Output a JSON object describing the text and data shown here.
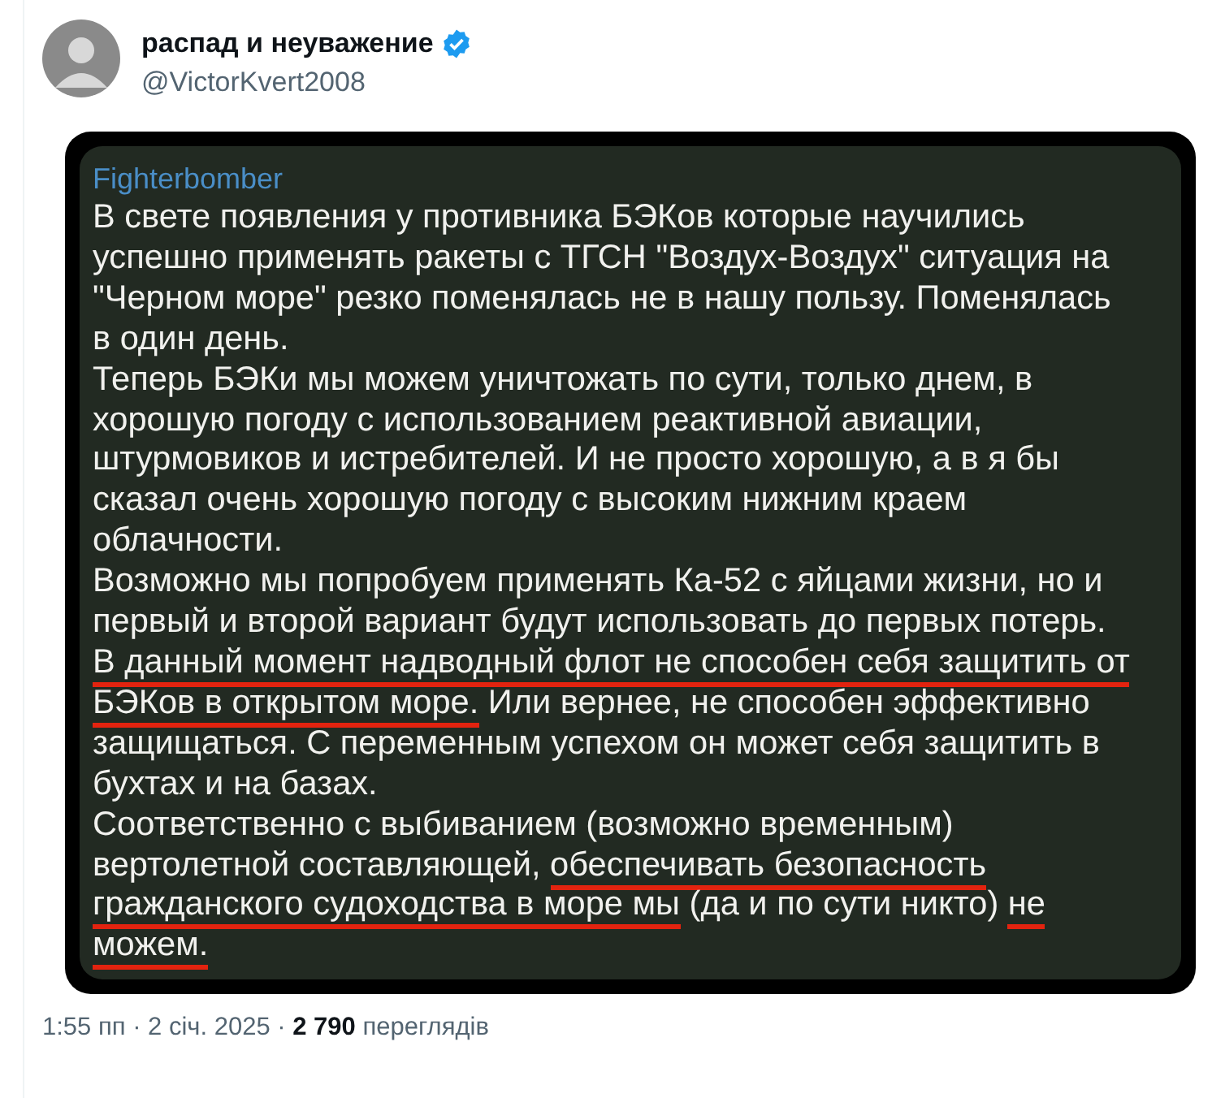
{
  "author": {
    "name": "распад и неуважение",
    "verified": true,
    "handle": "@VictorKvert2008"
  },
  "embedded_message": {
    "sender": "Fighterbomber",
    "lines": [
      [
        {
          "text": "В свете появления у противника БЭКов которые научились",
          "underlined": false
        }
      ],
      [
        {
          "text": "успешно применять ракеты с ТГСН \"Воздух-Воздух\" ситуация на",
          "underlined": false
        }
      ],
      [
        {
          "text": "\"Черном море\" резко поменялась не в нашу пользу. Поменялась",
          "underlined": false
        }
      ],
      [
        {
          "text": "в один день.",
          "underlined": false
        }
      ],
      [
        {
          "text": "Теперь БЭКи мы можем уничтожать по сути, только днем, в",
          "underlined": false
        }
      ],
      [
        {
          "text": "хорошую погоду с использованием реактивной авиации,",
          "underlined": false
        }
      ],
      [
        {
          "text": "штурмовиков и истребителей. И не просто хорошую, а в я бы",
          "underlined": false
        }
      ],
      [
        {
          "text": "сказал очень хорошую погоду с высоким нижним краем",
          "underlined": false
        }
      ],
      [
        {
          "text": "облачности.",
          "underlined": false
        }
      ],
      [
        {
          "text": "Возможно мы попробуем применять Ка-52 с яйцами жизни, но и",
          "underlined": false
        }
      ],
      [
        {
          "text": "первый и второй вариант будут использовать до первых потерь.",
          "underlined": false
        }
      ],
      [
        {
          "text": "В данный момент надводный флот не способен себя защитить от",
          "underlined": true
        }
      ],
      [
        {
          "text": "БЭКов в открытом море.",
          "underlined": true
        },
        {
          "text": " Или вернее, не способен эффективно",
          "underlined": false
        }
      ],
      [
        {
          "text": "защищаться. С переменным успехом он может себя защитить в",
          "underlined": false
        }
      ],
      [
        {
          "text": "бухтах и на базах.",
          "underlined": false
        }
      ],
      [
        {
          "text": "Соответственно с выбиванием (возможно временным)",
          "underlined": false
        }
      ],
      [
        {
          "text": "вертолетной составляющей, ",
          "underlined": false
        },
        {
          "text": "обеспечивать безопасность",
          "underlined": true
        }
      ],
      [
        {
          "text": "гражданского судоходства в море мы",
          "underlined": true
        },
        {
          "text": " (да и по сути никто) ",
          "underlined": false
        },
        {
          "text": "не",
          "underlined": true
        }
      ],
      [
        {
          "text": "можем.",
          "underlined": true
        }
      ]
    ]
  },
  "footer": "1:55 пп · 2 січ. 2025 · **2 790** переглядів"
}
